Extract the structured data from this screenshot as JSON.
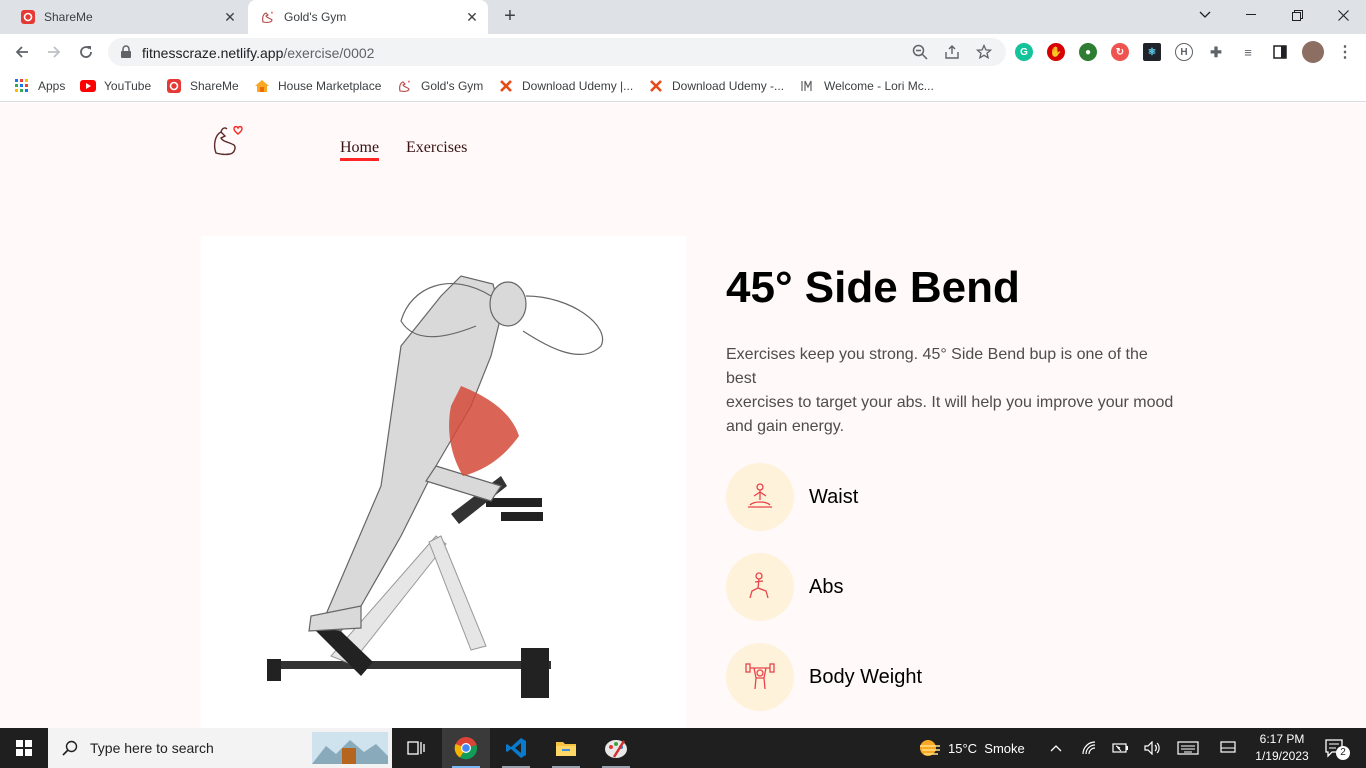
{
  "browser": {
    "tabs": [
      {
        "title": "ShareMe",
        "active": false
      },
      {
        "title": "Gold's Gym",
        "active": true
      }
    ],
    "url_host": "fitnesscraze.netlify.app",
    "url_path": "/exercise/0002",
    "bookmarks": [
      {
        "label": "Apps",
        "icon": "apps-grid-icon"
      },
      {
        "label": "YouTube",
        "icon": "youtube-icon"
      },
      {
        "label": "ShareMe",
        "icon": "shareme-icon"
      },
      {
        "label": "House Marketplace",
        "icon": "house-icon"
      },
      {
        "label": "Gold's Gym",
        "icon": "gym-icon"
      },
      {
        "label": "Download Udemy |...",
        "icon": "x-icon"
      },
      {
        "label": "Download Udemy -...",
        "icon": "x-icon"
      },
      {
        "label": "Welcome - Lori Mc...",
        "icon": "lm-icon"
      }
    ]
  },
  "site": {
    "nav": {
      "home": "Home",
      "exercises": "Exercises"
    },
    "exercise": {
      "title": "45° Side Bend",
      "description_line1": "Exercises keep you strong. 45° Side Bend bup is one of the best",
      "description_line2": "exercises to target your abs. It will help you improve your mood and gain energy.",
      "tags": [
        {
          "label": "Waist",
          "icon": "meditation-icon"
        },
        {
          "label": "Abs",
          "icon": "lunge-icon"
        },
        {
          "label": "Body Weight",
          "icon": "weightlifter-icon"
        }
      ]
    },
    "colors": {
      "accent": "#ff2625",
      "tag_bg": "#fff2db",
      "page_bg": "#fff9f9"
    }
  },
  "taskbar": {
    "search_placeholder": "Type here to search",
    "weather": "15°C  Smoke",
    "time": "6:17 PM",
    "date": "1/19/2023",
    "notifications": "2"
  }
}
